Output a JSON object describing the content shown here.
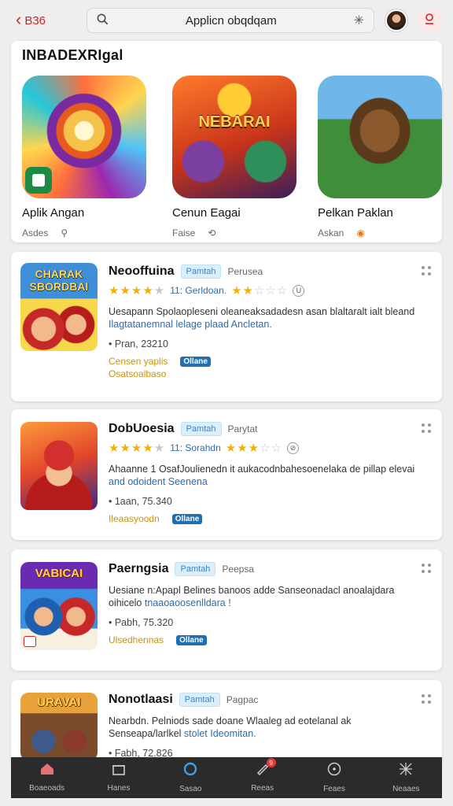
{
  "topbar": {
    "back_label": "B36",
    "search_value": "Applicn obqdqam"
  },
  "featured": {
    "heading": "INBADEXRIgal",
    "items": [
      {
        "name": "Aplik Angan",
        "meta": "Asdes",
        "icon": "play-store-icon"
      },
      {
        "name": "Cenun Eagai",
        "meta": "Faise",
        "art_text": "NEBARAI",
        "icon": "share-icon"
      },
      {
        "name": "Pelkan Paklan",
        "meta": "Askan",
        "icon": "badge-icon"
      }
    ]
  },
  "apps": [
    {
      "title": "Neooffuina",
      "badge": "Pamtah",
      "dev": "Perusea",
      "art_text": "CHARAK SBORDBAI",
      "rating": 4,
      "rating_text": "11: Gerldoan.",
      "rating2": 2.5,
      "desc_plain": "Uesapann Spolaopleseni oleaneaksadadesn asan blaltaralt ialt bleand ",
      "desc_link": "Ilagtatanemnal lelage plaad Ancletan.",
      "size": "• Pran, 23210",
      "tag_yellow": "Censen yaplis",
      "tag_blue": "Ollane",
      "sub": "Osatsoalbaso"
    },
    {
      "title": "DobUoesia",
      "badge": "Pamtah",
      "dev": "Parytat",
      "rating": 4,
      "rating_text": "11: Sorahdn",
      "rating2": 3,
      "desc_plain": "Ahaanne 1 OsafJoulienedn it aukacodnbahesoenelaka de pillap elevai ",
      "desc_link": "and odoident Seenena",
      "size": "• 1aan, 75.340",
      "tag_yellow": "Ileaasyoodn",
      "tag_blue": "Ollane",
      "sub": ""
    },
    {
      "title": "Paerngsia",
      "badge": "Pamtah",
      "dev": "Peepsa",
      "art_text": "VABICAI",
      "desc_plain": "Uesiane n:Apapl Belines banoos adde Sanseonadacl anoalajdara oihicelo ",
      "desc_link": "tnaaoaoosenlldara !",
      "size": "• Pabh, 75.320",
      "tag_yellow": "Ulsedhennas",
      "tag_blue": "Ollane",
      "sub": ""
    },
    {
      "title": "Nonotlaasi",
      "badge": "Pamtah",
      "dev": "Pagpac",
      "art_text": "URAVAI",
      "desc_plain": "Nearbdn. Pelniods sade doane Wlaaleg ad eotelanal ak Senseapa/larlkel ",
      "desc_link": "stolet Ideomitan.",
      "size": "• Fabh, 72.826",
      "tag_yellow": "",
      "tag_blue": "",
      "sub": ""
    }
  ],
  "bottomnav": [
    {
      "label": "Boaeoads",
      "icon": "home-icon",
      "active": true
    },
    {
      "label": "Hanes",
      "icon": "store-icon"
    },
    {
      "label": "Sasao",
      "icon": "circle-icon"
    },
    {
      "label": "Reeas",
      "icon": "edit-icon",
      "badge": "9"
    },
    {
      "label": "Feaes",
      "icon": "compass-icon"
    },
    {
      "label": "Neaaes",
      "icon": "puzzle-icon"
    }
  ],
  "colors": {
    "accent": "#c62828",
    "badge_bg": "#dbeefc",
    "star": "#f2b100",
    "nav_bg": "#2b2b2b"
  }
}
